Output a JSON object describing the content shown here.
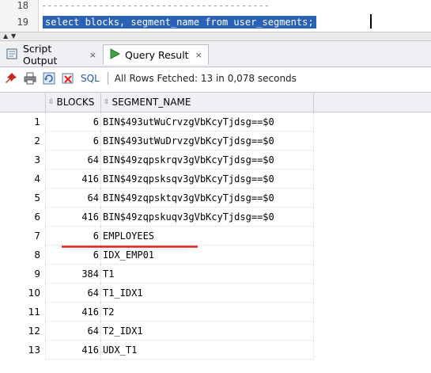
{
  "editor": {
    "lines": [
      {
        "number": "18",
        "text": "----------------------------------------"
      },
      {
        "number": "19",
        "text": "select blocks, segment_name from user_segments;"
      }
    ]
  },
  "tabs": [
    {
      "label": "Script Output",
      "close": "×",
      "icon": "script-output-icon"
    },
    {
      "label": "Query Result",
      "close": "×",
      "icon": "play-icon"
    }
  ],
  "toolbar": {
    "sql_label": "SQL",
    "separator": "|",
    "status": "All Rows Fetched: 13 in 0,078 seconds"
  },
  "grid": {
    "columns": [
      "BLOCKS",
      "SEGMENT_NAME"
    ],
    "rows": [
      {
        "n": "1",
        "blocks": "6",
        "segment_name": "BIN$493utWuCrvzgVbKcyTjdsg==$0"
      },
      {
        "n": "2",
        "blocks": "6",
        "segment_name": "BIN$493utWuDrvzgVbKcyTjdsg==$0"
      },
      {
        "n": "3",
        "blocks": "64",
        "segment_name": "BIN$49zqpskrqv3gVbKcyTjdsg==$0"
      },
      {
        "n": "4",
        "blocks": "416",
        "segment_name": "BIN$49zqpsksqv3gVbKcyTjdsg==$0"
      },
      {
        "n": "5",
        "blocks": "64",
        "segment_name": "BIN$49zqpsktqv3gVbKcyTjdsg==$0"
      },
      {
        "n": "6",
        "blocks": "416",
        "segment_name": "BIN$49zqpskuqv3gVbKcyTjdsg==$0"
      },
      {
        "n": "7",
        "blocks": "6",
        "segment_name": "EMPLOYEES"
      },
      {
        "n": "8",
        "blocks": "6",
        "segment_name": "IDX_EMP01"
      },
      {
        "n": "9",
        "blocks": "384",
        "segment_name": "T1"
      },
      {
        "n": "10",
        "blocks": "64",
        "segment_name": "T1_IDX1"
      },
      {
        "n": "11",
        "blocks": "416",
        "segment_name": "T2"
      },
      {
        "n": "12",
        "blocks": "64",
        "segment_name": "T2_IDX1"
      },
      {
        "n": "13",
        "blocks": "416",
        "segment_name": "UDX_T1"
      }
    ]
  },
  "colors": {
    "selection": "#2b62b6",
    "annotation": "#e0201a",
    "sql_link": "#2557a7"
  }
}
